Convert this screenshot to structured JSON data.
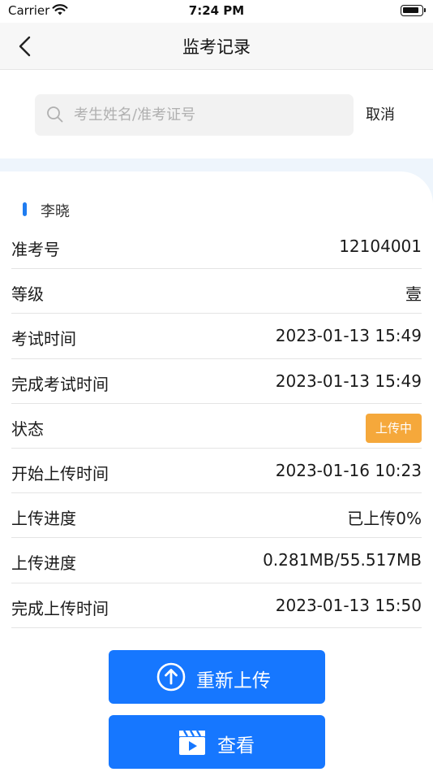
{
  "status_bar": {
    "carrier": "Carrier",
    "time": "7:24 PM"
  },
  "nav": {
    "title": "监考记录",
    "back_icon": "chevron-left-icon"
  },
  "search": {
    "placeholder": "考生姓名/准考证号",
    "value": "",
    "cancel_label": "取消",
    "icon": "search-icon"
  },
  "record": {
    "name": "李晓",
    "rows": [
      {
        "label": "准考号",
        "value": "12104001"
      },
      {
        "label": "等级",
        "value": "壹"
      },
      {
        "label": "考试时间",
        "value": "2023-01-13 15:49"
      },
      {
        "label": "完成考试时间",
        "value": "2023-01-13 15:49"
      },
      {
        "label": "状态",
        "value": "上传中"
      },
      {
        "label": "开始上传时间",
        "value": "2023-01-16 10:23"
      },
      {
        "label": "上传进度",
        "value": "已上传0%"
      },
      {
        "label": "上传进度",
        "value": "0.281MB/55.517MB"
      },
      {
        "label": "完成上传时间",
        "value": "2023-01-13 15:50"
      }
    ]
  },
  "actions": {
    "reupload_label": "重新上传",
    "reupload_icon": "upload-circle-icon",
    "view_label": "查看",
    "view_icon": "video-clapper-icon"
  },
  "colors": {
    "accent": "#1677ff",
    "badge": "#f5a83b",
    "name_marker": "#1f7cf0",
    "content_bg": "#eef5fc"
  }
}
